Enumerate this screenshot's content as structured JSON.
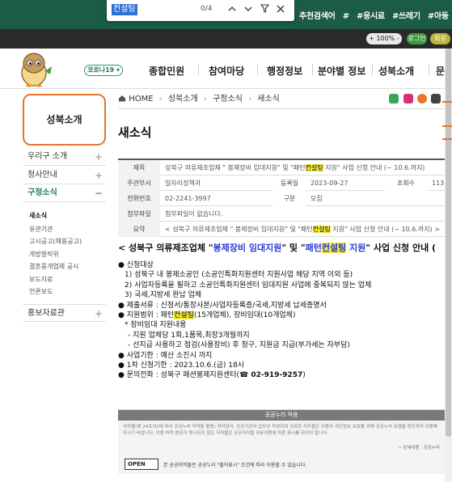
{
  "find_bar": {
    "query": "컨설팅",
    "count": "0/4"
  },
  "topbar": {
    "suggest_label": "추천검색어",
    "tags": [
      "#",
      "#응시료",
      "#쓰레기",
      "#아동"
    ]
  },
  "utility": {
    "zoom": "+ 100% -",
    "login": "로그인",
    "join": "회원"
  },
  "nav": {
    "covid": "코로나19 ▾",
    "menu": [
      "종합민원",
      "참여마당",
      "행정정보",
      "분야별 정보",
      "성북소개",
      "문"
    ]
  },
  "sidebar": {
    "title": "성북소개",
    "items": [
      {
        "label": "우리구 소개",
        "pm": "+"
      },
      {
        "label": "청사안내",
        "pm": "+"
      },
      {
        "label": "구정소식",
        "pm": "−"
      }
    ],
    "subitems": [
      "새소식",
      "유관기관",
      "고시공고(채용공고)",
      "개방형직위",
      "결혼중개업체 공시",
      "보도자료",
      "언론보도"
    ],
    "last_item": {
      "label": "홍보자료관",
      "pm": "+"
    }
  },
  "breadcrumb": [
    "HOME",
    "성북소개",
    "구정소식",
    "새소식"
  ],
  "page_title": "새소식",
  "info": {
    "subject_label": "제목",
    "subject_pre": "성북구 의류제조업체 \" 봉제장비 임대지원\" 및 \"패턴",
    "subject_hl": "컨설팅",
    "subject_post": " 지원\" 사업 신청 안내 (~ 10.6.까지)",
    "dept_label": "주관부서",
    "dept": "일자리정책과",
    "date_label": "등록일",
    "date": "2023-09-27",
    "views_label": "조회수",
    "views": "113",
    "phone_label": "전화번호",
    "phone": "02-2241-3997",
    "type_label": "구분",
    "type": "모집",
    "file_label": "첨부파일",
    "file": "첨부파일이 없습니다.",
    "summary_label": "요약",
    "summary_pre": "< 성북구 의류제조업체 \" 봉제장비 임대지원\" 및 \"패턴",
    "summary_hl": "컨설팅",
    "summary_post": " 지원\" 사업 신청 안내 (~ 10.6.까지) >"
  },
  "body": {
    "headline_a": "< 성북구 의류제조업체 \"",
    "headline_b": "봉제장비 임대지원",
    "headline_c": "\" 및 \"",
    "headline_d": "패턴",
    "headline_e": "컨설팅",
    "headline_f": " 지원",
    "headline_g": "\" 사업 신청 안내 (",
    "lines": [
      "● 신청대상",
      "1) 성북구 내 봉제소공인 (소공인특화지원센터 지원사업 해당 지역 이외 등)",
      "2) 사업자등록을 필하고 소공인특화지원센터 임대지원 사업에 중복되지 않는 업체",
      "3) 국세,지방세 완납 업체",
      "● 제출서류 : 신청서/통장사본/사업자등록증/국세,지방세 납세증명서"
    ],
    "scope_pre": "● 지원범위 : 패턴",
    "scope_hl": "컨설팅",
    "scope_post": "(15개업체), 장비임대(10개업체)",
    "lines2": [
      "* 장비임대 지원내용",
      "- 지원 업체당 1회,1품목,최장3개월까지",
      "- 선지급 사용하고 점검(사용장비) 후 청구, 지원금 지급(부가세는 자부담)",
      "● 사업기한 :  예산 소진시 까지",
      "● 1차 신청기한 : 2023.10.6.(금) 18시"
    ],
    "contact_pre": "● 문의전화 : 성북구 패션봉제지원센터(",
    "contact_phone": "☎ 02-919-9257",
    "contact_post": ")"
  },
  "footer": {
    "head": "공공누리 적용",
    "desc": "저작물(제 24조의2에 따라 공공누리 저작물 활용) 저작권자, 공공기관이 업무상 작성하여 공표한 저작물은 이용자 개인정보 보호를 위해 공공누리 유형을 확인하여 이용해 주시기 바랍니다. 이용 허락 범위가 명시되지 않은 저작물은 공공저작물 자유이용에 따른 표시를 하여야 합니다.",
    "more": "» 상세내용 : 공공누리",
    "badge": "OPEN",
    "note": "본 공공저작물은 공공누리 \"출처표시\" 조건에 따라 이용할 수 있습니다."
  }
}
